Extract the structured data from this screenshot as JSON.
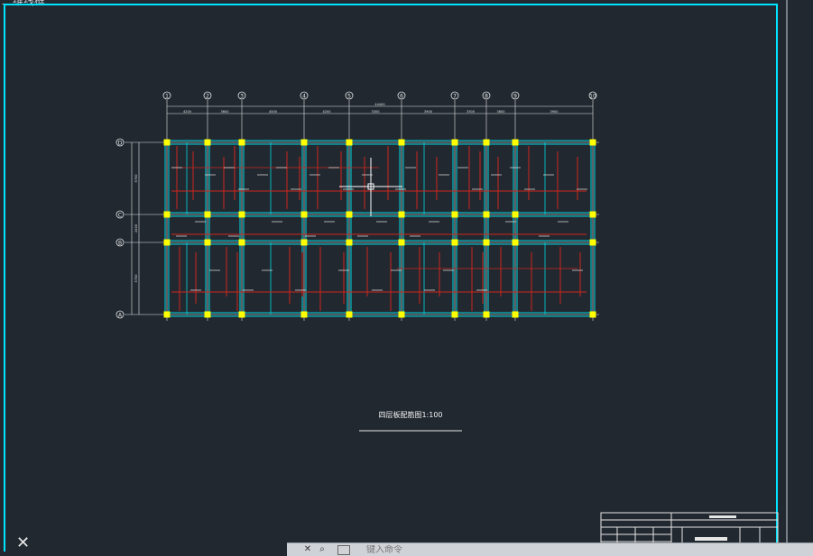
{
  "viewport": {
    "label": "二维线框",
    "background": "#212830"
  },
  "drawing": {
    "grid_bubbles_top": [
      "1",
      "2",
      "3",
      "4",
      "5",
      "6",
      "7",
      "8",
      "9",
      "10"
    ],
    "grid_bubbles_left": [
      "D",
      "C",
      "B",
      "A"
    ],
    "dimension_total": "44400",
    "dimension_spans": [
      "4200",
      "3600",
      "4500",
      "4200",
      "3300",
      "3900",
      "3300",
      "3600",
      "3900"
    ],
    "dimension_left": [
      "5700",
      "2400",
      "5700"
    ],
    "plan_title": "四层板配筋图1:100",
    "colors": {
      "frame": "#00e5ff",
      "grid": "#e6e6e6",
      "beam": "#00d8e0",
      "rebar": "#d0261c",
      "column": "#ffff00"
    }
  },
  "ui": {
    "close_glyph": "✕",
    "command_placeholder": "键入命令",
    "command_buttons": [
      "✕",
      "⌕"
    ]
  }
}
